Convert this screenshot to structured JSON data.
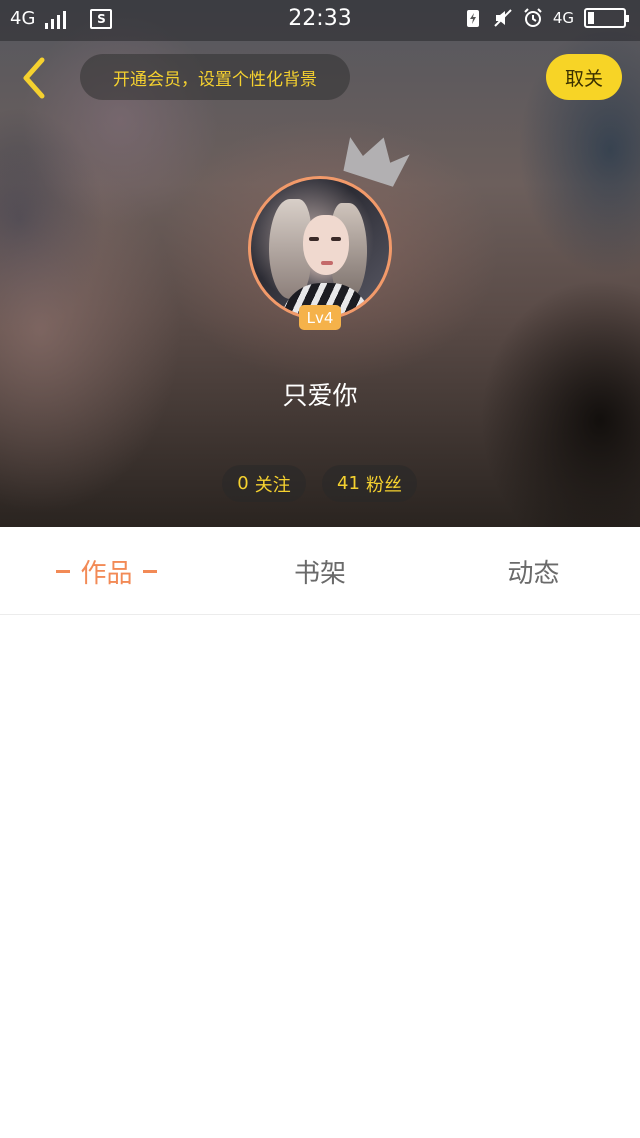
{
  "status_bar": {
    "network_left": "4G",
    "time": "22:33",
    "network_right": "4G"
  },
  "header": {
    "vip_banner_text": "开通会员，设置个性化背景",
    "cancel_follow_label": "取关"
  },
  "profile": {
    "level": "Lv4",
    "username": "只爱你",
    "following_count": "0",
    "following_label": "关注",
    "fans_count": "41",
    "fans_label": "粉丝"
  },
  "tabs": [
    {
      "label": "作品",
      "active": true
    },
    {
      "label": "书架",
      "active": false
    },
    {
      "label": "动态",
      "active": false
    }
  ],
  "colors": {
    "accent_yellow": "#f7d426",
    "tab_active": "#f28a56",
    "avatar_ring": "#f29a6a",
    "level_badge": "#f5b24a"
  }
}
